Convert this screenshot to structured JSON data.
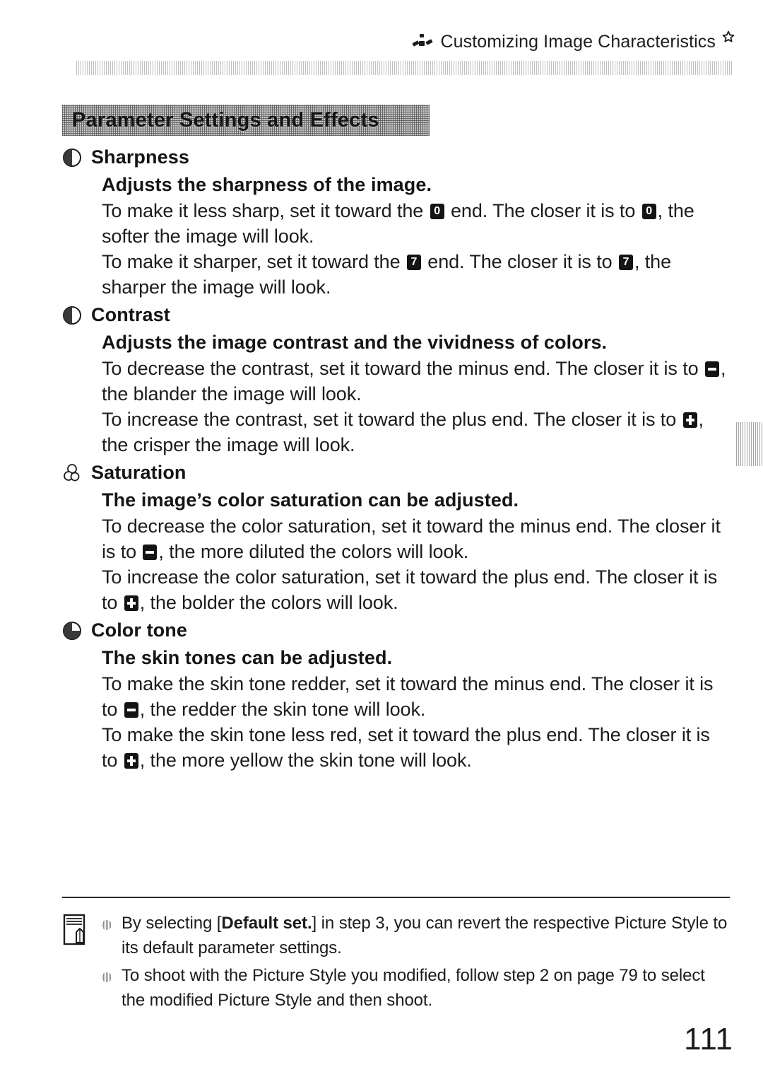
{
  "running_head": {
    "icon": "picture-style-icon",
    "title": "Customizing Image Characteristics",
    "star": "star-icon"
  },
  "banner": {
    "title": "Parameter Settings and Effects"
  },
  "parameters": [
    {
      "icon": "sharpness-dial-icon",
      "title": "Sharpness",
      "subtitle": "Adjusts the sharpness of the image.",
      "lines": [
        {
          "parts": [
            {
              "t": "text",
              "v": "To make it less sharp, set it toward the "
            },
            {
              "t": "key",
              "v": "0",
              "name": "key-icon-zero"
            },
            {
              "t": "text",
              "v": " end. The closer it is to "
            },
            {
              "t": "key",
              "v": "0",
              "name": "key-icon-zero"
            },
            {
              "t": "text",
              "v": ", the softer the image will look."
            }
          ]
        },
        {
          "parts": [
            {
              "t": "text",
              "v": "To make it sharper, set it toward the "
            },
            {
              "t": "key",
              "v": "7",
              "name": "key-icon-seven"
            },
            {
              "t": "text",
              "v": " end. The closer it is to "
            },
            {
              "t": "key",
              "v": "7",
              "name": "key-icon-seven"
            },
            {
              "t": "text",
              "v": ", the sharper the image will look."
            }
          ]
        }
      ]
    },
    {
      "icon": "contrast-dial-icon",
      "title": "Contrast",
      "subtitle": "Adjusts the image contrast and the vividness of colors.",
      "lines": [
        {
          "parts": [
            {
              "t": "text",
              "v": "To decrease the contrast, set it toward the minus end. The closer it is to "
            },
            {
              "t": "minus",
              "v": "-",
              "name": "key-icon-minus"
            },
            {
              "t": "text",
              "v": ", the blander the image will look."
            }
          ]
        },
        {
          "parts": [
            {
              "t": "text",
              "v": "To increase the contrast, set it toward the plus end. The closer it is to "
            },
            {
              "t": "plus",
              "v": "+",
              "name": "key-icon-plus"
            },
            {
              "t": "text",
              "v": ", the crisper the image will look."
            }
          ]
        }
      ]
    },
    {
      "icon": "saturation-cluster-icon",
      "title": "Saturation",
      "subtitle": "The image’s color saturation can be adjusted.",
      "lines": [
        {
          "parts": [
            {
              "t": "text",
              "v": "To decrease the color saturation, set it toward the minus end. The closer it is to "
            },
            {
              "t": "minus",
              "v": "-",
              "name": "key-icon-minus"
            },
            {
              "t": "text",
              "v": ", the more diluted the colors will look."
            }
          ]
        },
        {
          "parts": [
            {
              "t": "text",
              "v": "To increase the color saturation, set it toward the plus end. The closer it is to "
            },
            {
              "t": "plus",
              "v": "+",
              "name": "key-icon-plus"
            },
            {
              "t": "text",
              "v": ", the bolder the colors will look."
            }
          ]
        }
      ]
    },
    {
      "icon": "color-tone-dial-icon",
      "title": "Color tone",
      "subtitle": "The skin tones can be adjusted.",
      "lines": [
        {
          "parts": [
            {
              "t": "text",
              "v": "To make the skin tone redder, set it toward the minus end. The closer it is to "
            },
            {
              "t": "minus",
              "v": "-",
              "name": "key-icon-minus"
            },
            {
              "t": "text",
              "v": ", the redder the skin tone will look."
            }
          ]
        },
        {
          "parts": [
            {
              "t": "text",
              "v": "To make the skin tone less red, set it toward the plus end. The closer it is to "
            },
            {
              "t": "plus",
              "v": "+",
              "name": "key-icon-plus"
            },
            {
              "t": "text",
              "v": ", the more yellow the skin tone will look."
            }
          ]
        }
      ]
    }
  ],
  "footnote": {
    "icon": "note-pad-icon",
    "items": [
      {
        "parts": [
          {
            "t": "text",
            "v": "By selecting ["
          },
          {
            "t": "bold",
            "v": "Default set."
          },
          {
            "t": "text",
            "v": "] in step 3, you can revert the respective Picture Style to its default parameter settings."
          }
        ]
      },
      {
        "parts": [
          {
            "t": "text",
            "v": "To shoot with the Picture Style you modified, follow step 2 on page 79 to select the modified Picture Style and then shoot."
          }
        ]
      }
    ]
  },
  "page_number": "111",
  "colors": {
    "text": "#1c1c1c",
    "banner_bg": "#c9c9c9",
    "key_icon_bg": "#141414",
    "rule": "#9a9a9a"
  }
}
